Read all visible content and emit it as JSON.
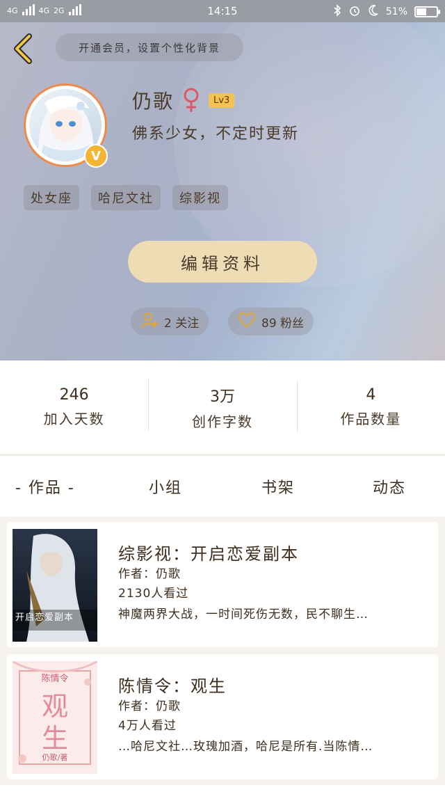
{
  "status_bar": {
    "network1": "4G",
    "network2": "4G",
    "network3": "2G",
    "time": "14:15",
    "battery_percent": 51,
    "battery_label": "51%"
  },
  "header": {
    "vip_banner": "开通会员，设置个性化背景",
    "username": "仍歌",
    "gender_symbol": "♀",
    "level": "Lv3",
    "bio": "佛系少女，不定时更新",
    "badge": "V",
    "tags": [
      "处女座",
      "哈尼文社",
      "综影视"
    ],
    "edit_button": "编辑资料",
    "following_label": "2 关注",
    "fans_label": "89 粉丝"
  },
  "stats": [
    {
      "value": "246",
      "label": "加入天数"
    },
    {
      "value": "3万",
      "label": "创作字数"
    },
    {
      "value": "4",
      "label": "作品数量"
    }
  ],
  "tabs": [
    "- 作品 -",
    "小组",
    "书架",
    "动态"
  ],
  "works": [
    {
      "title": "综影视：开启恋爱副本",
      "author": "作者：仍歌",
      "views": "2130人看过",
      "summary": "神魔两界大战，一时间死伤无数，民不聊生…",
      "cover_text": "开启恋爱副本"
    },
    {
      "title": "陈情令：观生",
      "author": "作者：仍歌",
      "views": "4万人看过",
      "summary": "…哈尼文社…玫瑰加酒，哈尼是所有.当陈情…",
      "cover_text_top": "陈情令",
      "cover_text_main1": "观",
      "cover_text_main2": "生",
      "cover_text_bottom": "仍歌/著"
    }
  ],
  "colors": {
    "accent_orange": "#ef8a4a",
    "level_yellow": "#f4c250",
    "edit_button_bg": "#eedcb5"
  }
}
